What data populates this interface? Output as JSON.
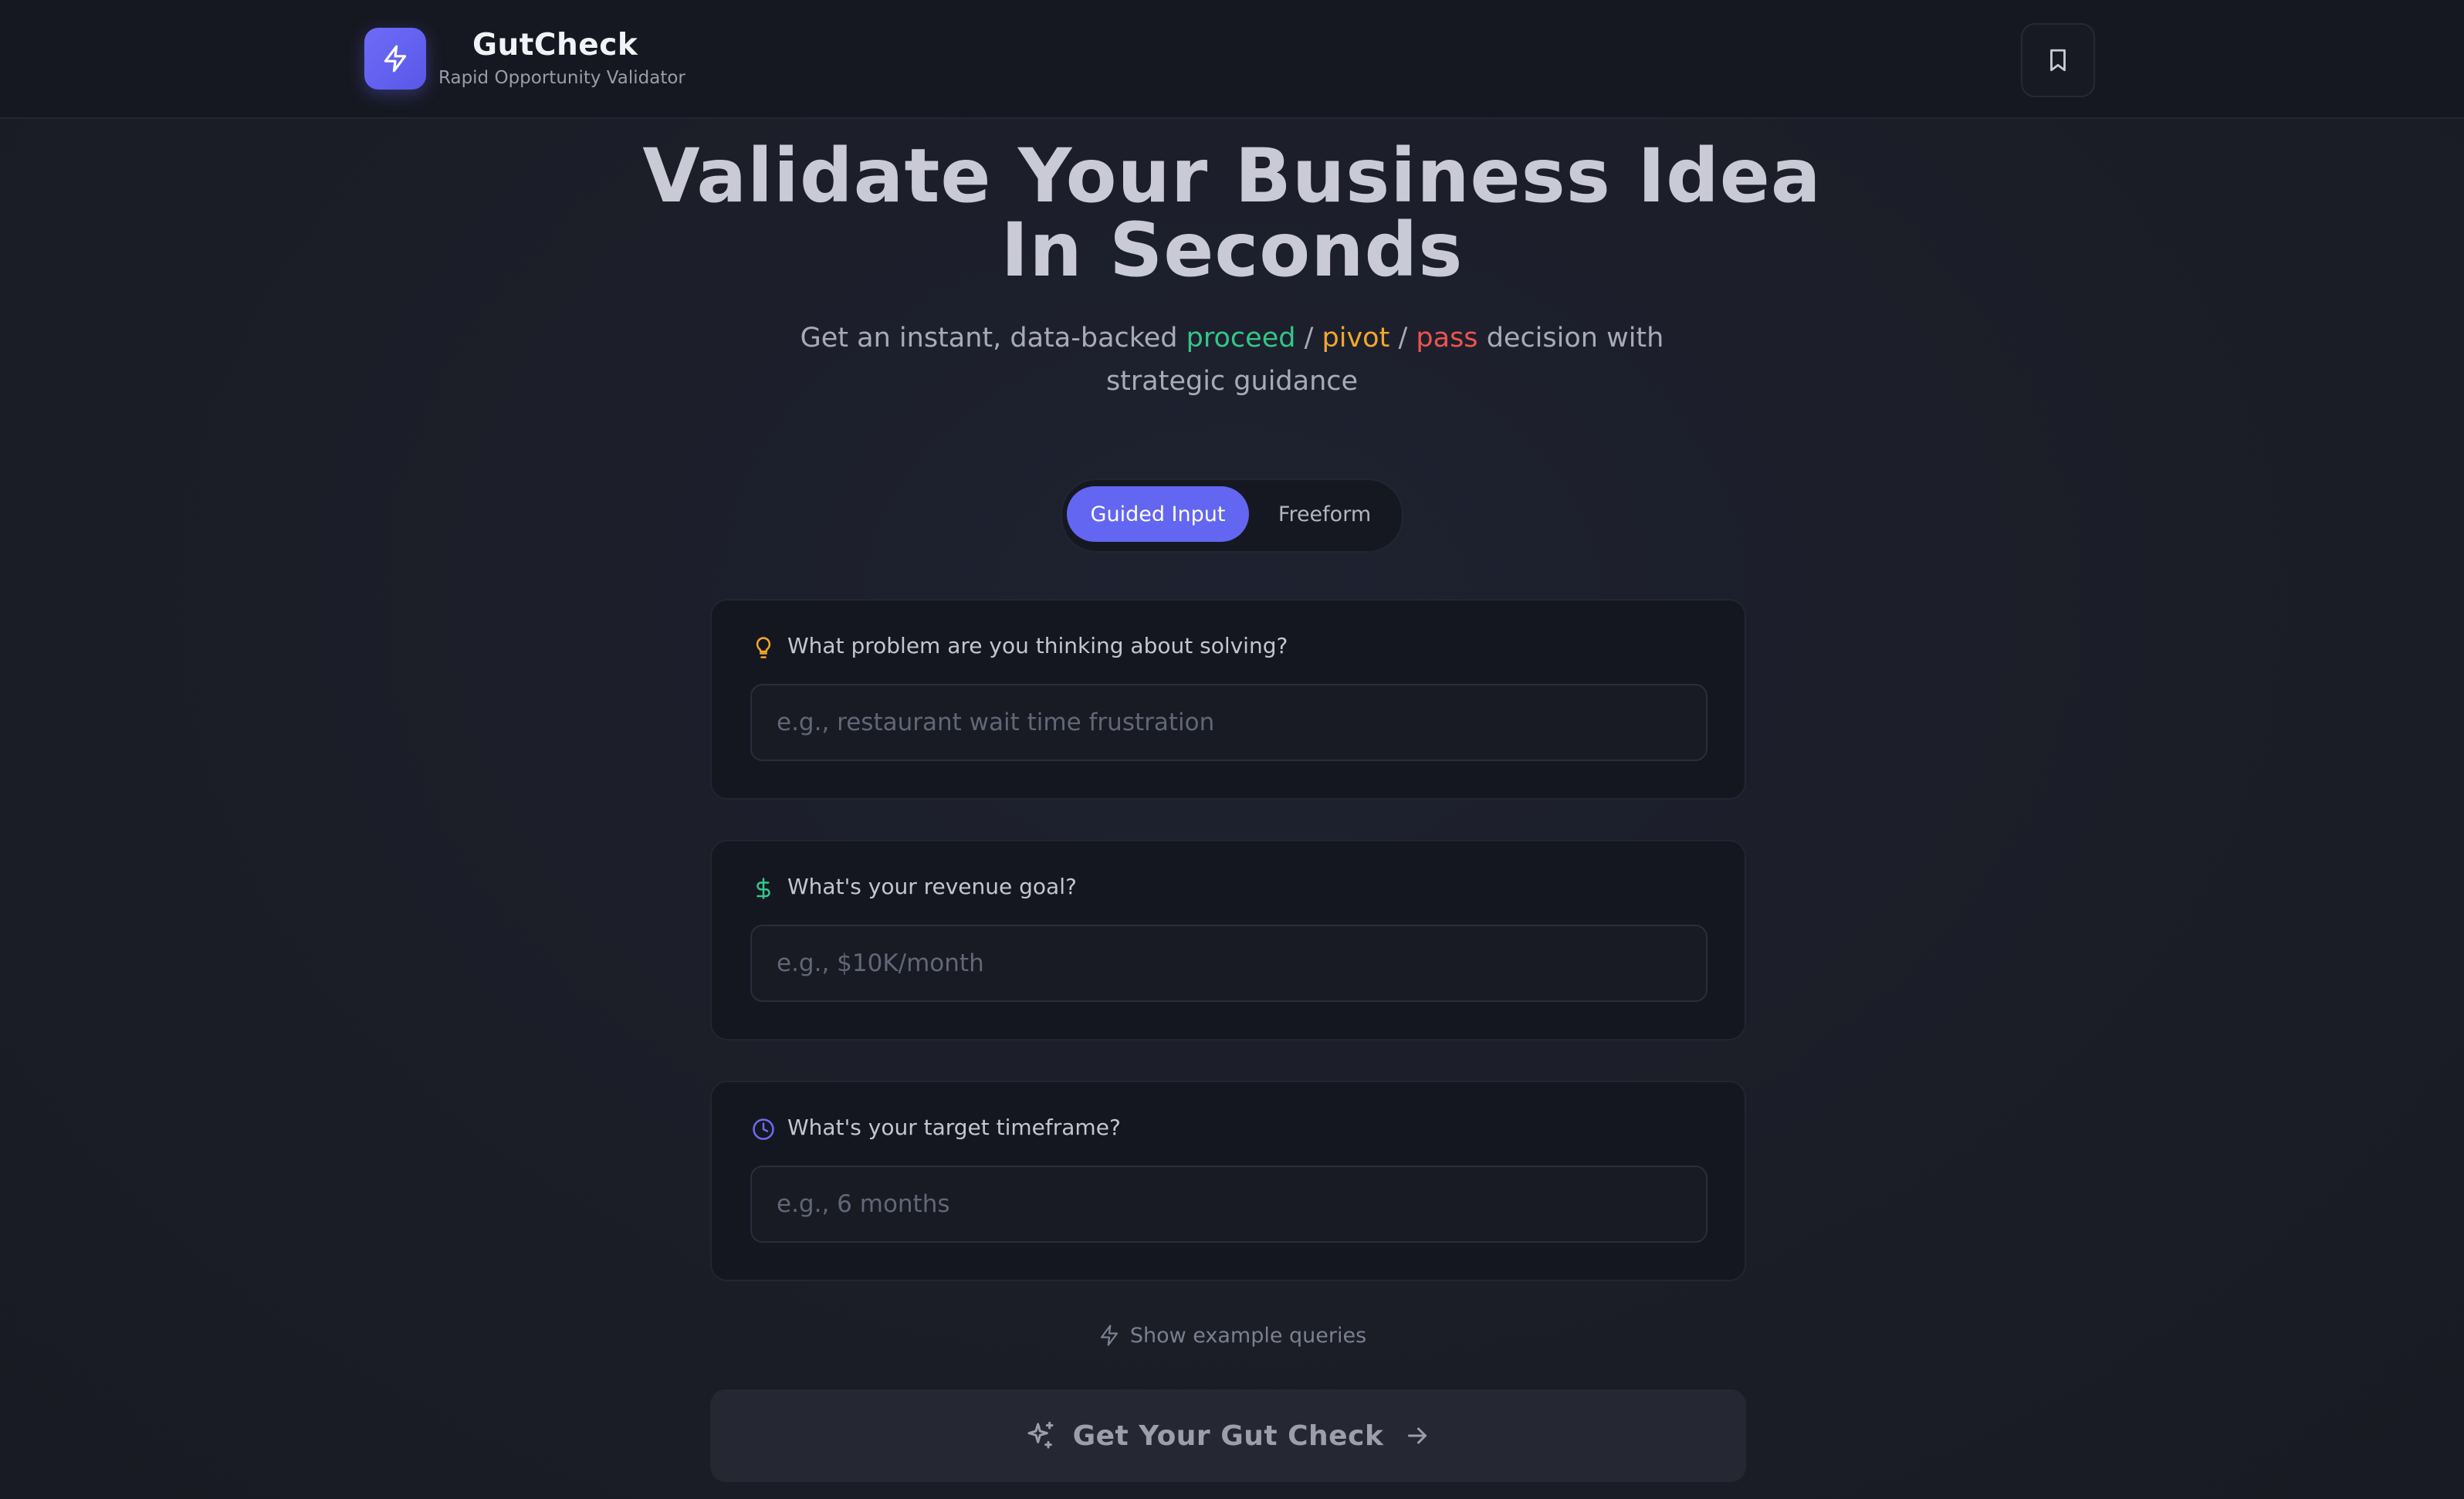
{
  "header": {
    "brand_name": "GutCheck",
    "brand_tagline": "Rapid Opportunity Validator",
    "logo_icon": "lightning-icon",
    "bookmark_icon": "bookmark-icon"
  },
  "hero": {
    "title_line1": "Validate Your Business Idea",
    "title_line2": "In Seconds",
    "subtitle_prefix": "Get an instant, data-backed",
    "word_proceed": "proceed",
    "slash": "/",
    "word_pivot": "pivot",
    "word_pass": "pass",
    "subtitle_suffix": "decision with",
    "subtitle_line2": "strategic guidance"
  },
  "mode_toggle": {
    "options": [
      "Guided Input",
      "Freeform"
    ],
    "selected": "Guided Input"
  },
  "fields": [
    {
      "label": "What problem are you thinking about solving?",
      "placeholder": "e.g., restaurant wait time frustration",
      "value": "",
      "icon": "lightbulb-icon"
    },
    {
      "label": "What's your revenue goal?",
      "placeholder": "e.g., $10K/month",
      "value": "",
      "icon": "dollar-icon"
    },
    {
      "label": "What's your target timeframe?",
      "placeholder": "e.g., 6 months",
      "value": "",
      "icon": "clock-icon"
    }
  ],
  "examples_link": "Show example queries",
  "submit_label": "Get Your Gut Check",
  "colors": {
    "accent": "#6366f1",
    "proceed": "#34c58a",
    "pivot": "#f3a72c",
    "pass": "#ef5350",
    "background": "#1b1d27"
  }
}
